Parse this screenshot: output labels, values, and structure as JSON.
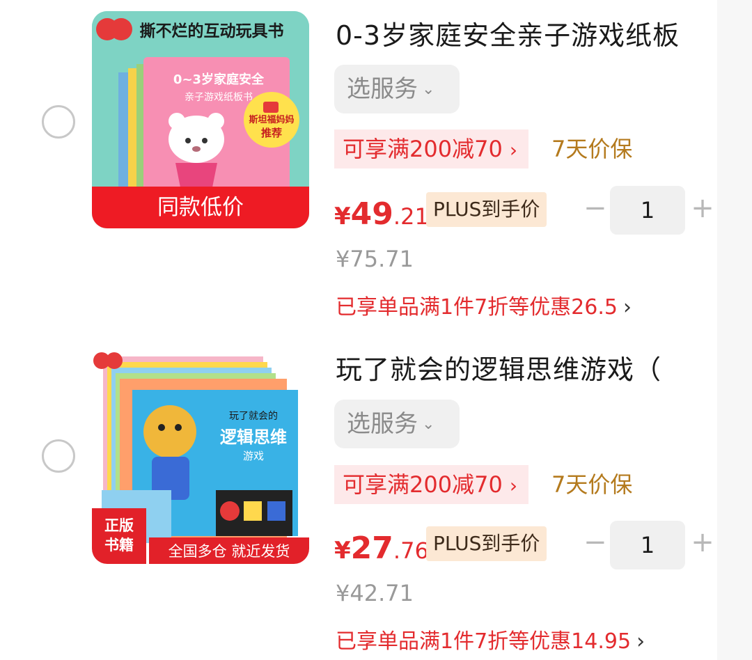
{
  "items": [
    {
      "title": "0-3岁家庭安全亲子游戏纸板",
      "service_label": "选服务",
      "promo": "可享满200减70",
      "guarantee": "7天价保",
      "price_yen": "¥",
      "price_int": "49",
      "price_dec": ".21",
      "plus_tag": "PLUS到手价",
      "quantity": "1",
      "original_price": "¥75.71",
      "saved_text": "已享单品满1件7折等优惠26.5",
      "image": {
        "banner": "撕不烂的互动玩具书",
        "book_title_1": "0~3岁家庭安全",
        "book_title_2": "亲子游戏纸板书",
        "badge_1": "斯坦福妈妈",
        "badge_2": "推荐",
        "bottom_label": "同款低价"
      }
    },
    {
      "title": "玩了就会的逻辑思维游戏（",
      "service_label": "选服务",
      "promo": "可享满200减70",
      "guarantee": "7天价保",
      "price_yen": "¥",
      "price_int": "27",
      "price_dec": ".76",
      "plus_tag": "PLUS到手价",
      "quantity": "1",
      "original_price": "¥42.71",
      "saved_text": "已享单品满1件7折等优惠14.95",
      "image": {
        "book_title_1": "玩了就会的",
        "book_title_2": "逻辑思维",
        "book_title_3": "游戏",
        "corner_1": "正版",
        "corner_2": "书籍",
        "bottom_label": "全国多仓 就近发货"
      }
    }
  ],
  "icons": {
    "chevron": "›",
    "minus": "−",
    "plus": "+"
  },
  "colors": {
    "accent_red": "#e32b2e",
    "promo_bg": "#fde9ea",
    "guarantee": "#b47a1d",
    "plus_tag_bg": "#fce8d4"
  }
}
